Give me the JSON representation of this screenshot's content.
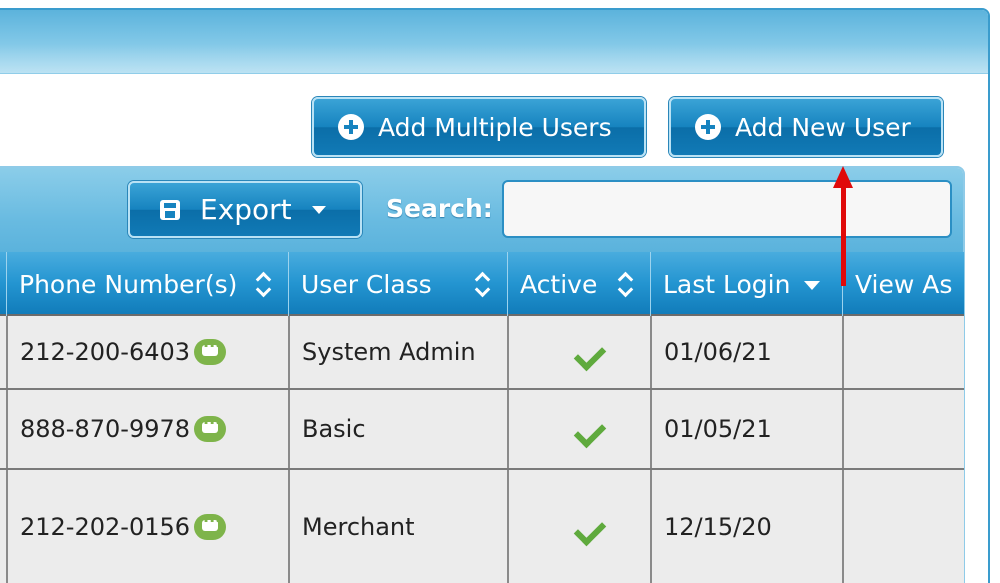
{
  "actions": {
    "add_multiple_users": "Add Multiple Users",
    "add_new_user": "Add New User"
  },
  "toolbar": {
    "export_label": "Export",
    "search_label": "Search:",
    "search_value": ""
  },
  "table": {
    "columns": [
      "Phone Number(s)",
      "User Class",
      "Active",
      "Last Login",
      "View As"
    ],
    "rows": [
      {
        "phone": "212-200-6403",
        "user_class": "System Admin",
        "active": true,
        "last_login": "01/06/21",
        "view_as": ""
      },
      {
        "phone": "888-870-9978",
        "user_class": "Basic",
        "active": true,
        "last_login": "01/05/21",
        "view_as": ""
      },
      {
        "phone": "212-202-0156",
        "user_class": "Merchant",
        "active": true,
        "last_login": "12/15/20",
        "view_as": ""
      }
    ]
  },
  "icons": {
    "add": "plus-circle-icon",
    "export": "save-icon",
    "sms": "chat-bubble-icon",
    "active": "check-icon",
    "sort": "sort-icon",
    "sorted_desc": "sort-desc-icon",
    "annotation": "red-arrow"
  },
  "colors": {
    "button_blue": "#1683bf",
    "header_blue": "#2495d1",
    "check_green": "#5faa3d",
    "chat_green": "#7eb44a",
    "arrow_red": "#e00a0a"
  }
}
